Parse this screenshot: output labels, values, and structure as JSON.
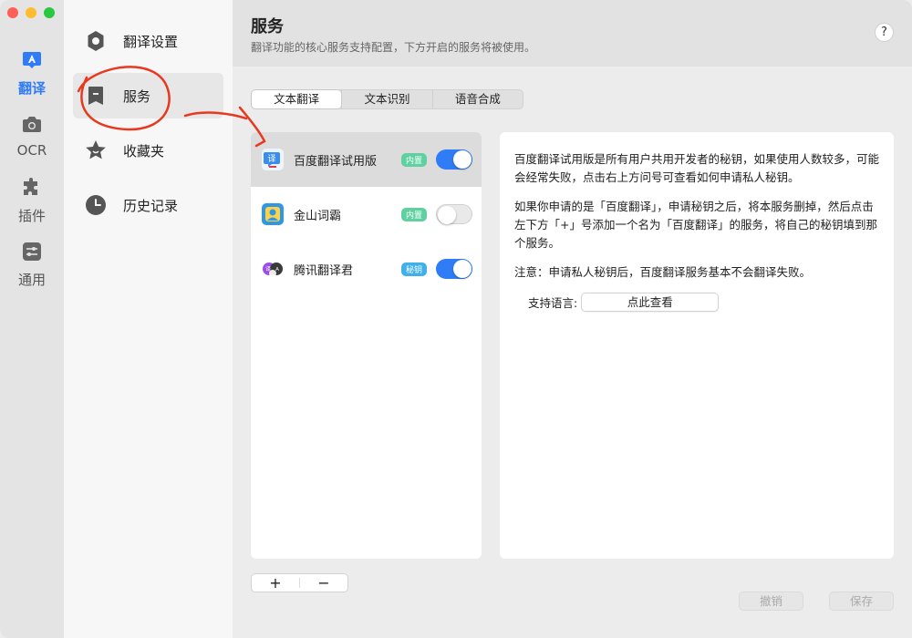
{
  "rail": {
    "items": [
      {
        "label": "翻译",
        "icon": "translate-icon",
        "active": true
      },
      {
        "label": "OCR",
        "icon": "camera-icon",
        "active": false
      },
      {
        "label": "插件",
        "icon": "puzzle-icon",
        "active": false
      },
      {
        "label": "通用",
        "icon": "sliders-icon",
        "active": false
      }
    ]
  },
  "subbar": {
    "items": [
      {
        "label": "翻译设置",
        "icon": "gear-icon"
      },
      {
        "label": "服务",
        "icon": "bookmark-icon"
      },
      {
        "label": "收藏夹",
        "icon": "star-icon"
      },
      {
        "label": "历史记录",
        "icon": "clock-icon"
      }
    ]
  },
  "header": {
    "title": "服务",
    "subtitle": "翻译功能的核心服务支持配置，下方开启的服务将被使用。",
    "help": "?"
  },
  "tabs": [
    {
      "label": "文本翻译",
      "active": true
    },
    {
      "label": "文本识别",
      "active": false
    },
    {
      "label": "语音合成",
      "active": false
    }
  ],
  "services": [
    {
      "name": "百度翻译试用版",
      "badge": "内置",
      "badge_color": "#5fd1a0",
      "enabled": true
    },
    {
      "name": "金山词霸",
      "badge": "内置",
      "badge_color": "#5fd1a0",
      "enabled": false
    },
    {
      "name": "腾讯翻译君",
      "badge": "秘钥",
      "badge_color": "#3fb1e8",
      "enabled": true
    }
  ],
  "detail": {
    "para1": "百度翻译试用版是所有用户共用开发者的秘钥，如果使用人数较多，可能会经常失败，点击右上方问号可查看如何申请私人秘钥。",
    "para2": "如果你申请的是「百度翻译」，申请秘钥之后，将本服务删掉，然后点击左下方「+」号添加一个名为「百度翻译」的服务，将自己的秘钥填到那个服务。",
    "para3": "注意：申请私人秘钥后，百度翻译服务基本不会翻译失败。",
    "lang_label": "支持语言:",
    "lang_button": "点此查看"
  },
  "footer": {
    "add": "+",
    "remove": "−",
    "revert": "撤销",
    "save": "保存"
  },
  "colors": {
    "accent": "#2f7cf6",
    "toggle_on": "#2f7cf6",
    "toggle_off": "#e9e9e9",
    "annotation": "#e8381f"
  }
}
